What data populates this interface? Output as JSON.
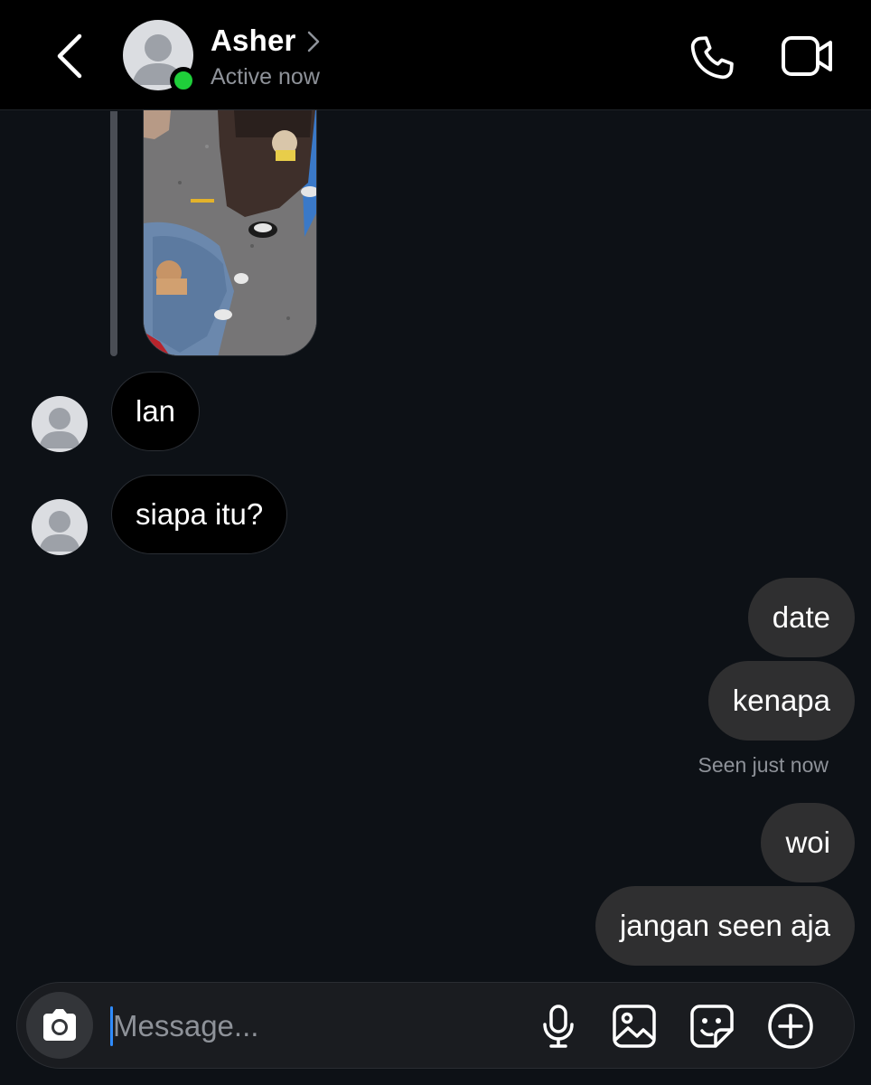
{
  "header": {
    "contact_name": "Asher",
    "status": "Active now"
  },
  "messages_incoming": [
    {
      "text": "lan"
    },
    {
      "text": "siapa itu?"
    }
  ],
  "messages_outgoing": [
    {
      "text": "date"
    },
    {
      "text": "kenapa"
    },
    {
      "text": "woi"
    },
    {
      "text": "jangan seen aja"
    }
  ],
  "seen_status": "Seen just now",
  "composer": {
    "placeholder": "Message..."
  },
  "colors": {
    "online": "#1fcf3a",
    "outgoing_bubble": "#2f2f30",
    "incoming_bubble": "#000000",
    "caret": "#2f8cff"
  }
}
